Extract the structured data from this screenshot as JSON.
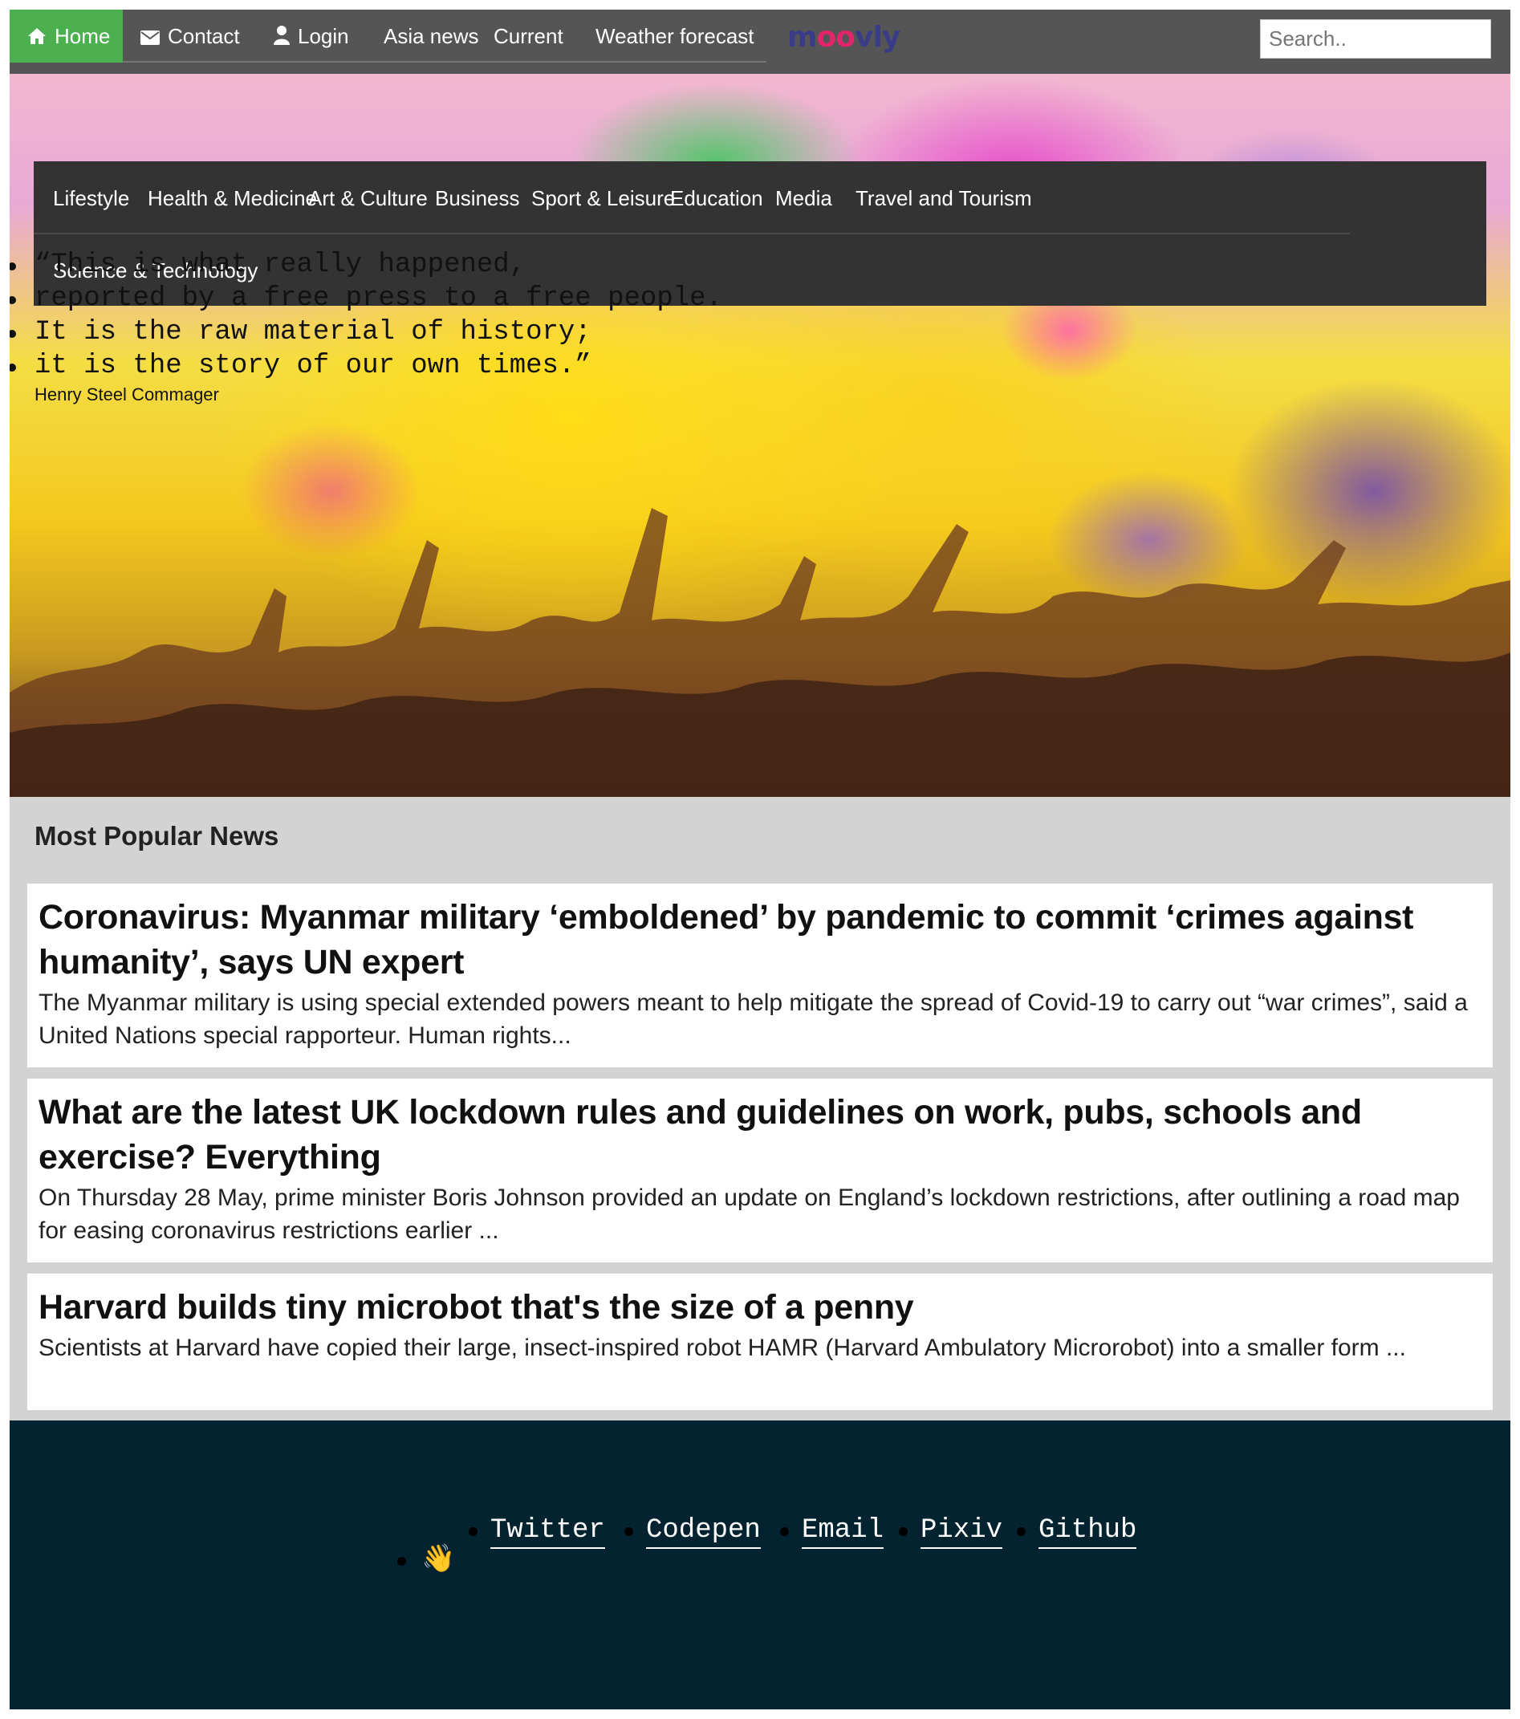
{
  "topnav": {
    "home": "Home",
    "contact": "Contact",
    "login": "Login",
    "asia_news": "Asia news",
    "current": "Current",
    "weather": "Weather forecast",
    "logo_prefix": "m",
    "logo_oo": "oo",
    "logo_suffix": "vly",
    "search_placeholder": "Search.."
  },
  "categories": [
    "Lifestyle",
    "Health & Medicine",
    "Art & Culture",
    "Business",
    "Sport & Leisure",
    "Education",
    "Media",
    "Travel and Tourism",
    "Science & Technology"
  ],
  "quote": {
    "lines": [
      "“This is what really happened,",
      "reported by a free press to a free people.",
      "It is the raw material of history;",
      "it is the story of our own times.”"
    ],
    "author": "Henry Steel Commager"
  },
  "news": {
    "heading": "Most Popular News",
    "articles": [
      {
        "title": "Coronavirus: Myanmar military ‘emboldened’ by pandemic to commit ‘crimes against humanity’, says UN expert",
        "summary": "The Myanmar military is using special extended powers meant to help mitigate the spread of Covid-19 to carry out “war crimes”, said a United Nations special rapporteur. Human rights..."
      },
      {
        "title": "What are the latest UK lockdown rules and guidelines on work, pubs, schools and exercise? Everything",
        "summary": "On Thursday 28 May, prime minister Boris Johnson provided an update on England’s lockdown restrictions, after outlining a road map for easing coronavirus restrictions earlier ..."
      },
      {
        "title": "Harvard builds tiny microbot that's the size of a penny",
        "summary": "Scientists at Harvard have copied their large, insect-inspired robot HAMR (Harvard Ambulatory Microrobot) into a smaller form ..."
      }
    ]
  },
  "footer": {
    "links": [
      "Twitter",
      "Codepen",
      "Email",
      "Pixiv",
      "Github"
    ],
    "wave": "👋"
  },
  "icons": {
    "home": "home-icon",
    "contact": "envelope-icon",
    "login": "user-icon"
  },
  "colors": {
    "nav_bg": "#555555",
    "home_active": "#4CAF50",
    "category_bg": "#333333",
    "news_bg": "#d3d3d3",
    "footer_bg": "#032330"
  }
}
